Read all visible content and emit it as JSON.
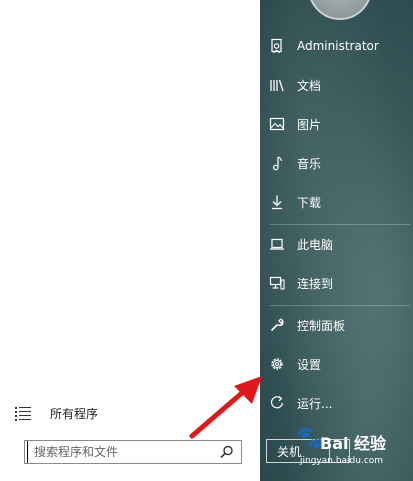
{
  "left_panel": {
    "all_programs_label": "所有程序",
    "search_placeholder": "搜索程序和文件"
  },
  "right_panel": {
    "items": [
      {
        "label": "Administrator",
        "icon": "user-document-icon"
      },
      {
        "label": "文档",
        "icon": "library-books-icon"
      },
      {
        "label": "图片",
        "icon": "picture-icon"
      },
      {
        "label": "音乐",
        "icon": "music-note-icon"
      },
      {
        "label": "下载",
        "icon": "download-icon"
      },
      {
        "label": "此电脑",
        "icon": "laptop-icon"
      },
      {
        "label": "连接到",
        "icon": "network-monitor-icon"
      },
      {
        "label": "控制面板",
        "icon": "wrench-icon"
      },
      {
        "label": "设置",
        "icon": "gear-icon"
      },
      {
        "label": "运行...",
        "icon": "run-icon"
      }
    ],
    "shutdown_label": "关机"
  },
  "watermark": {
    "brand": "Bai  经验",
    "url": "jingyan.baidu.com"
  },
  "colors": {
    "panel_dark": "#2f4d50",
    "arrow_red": "#e0181b"
  }
}
